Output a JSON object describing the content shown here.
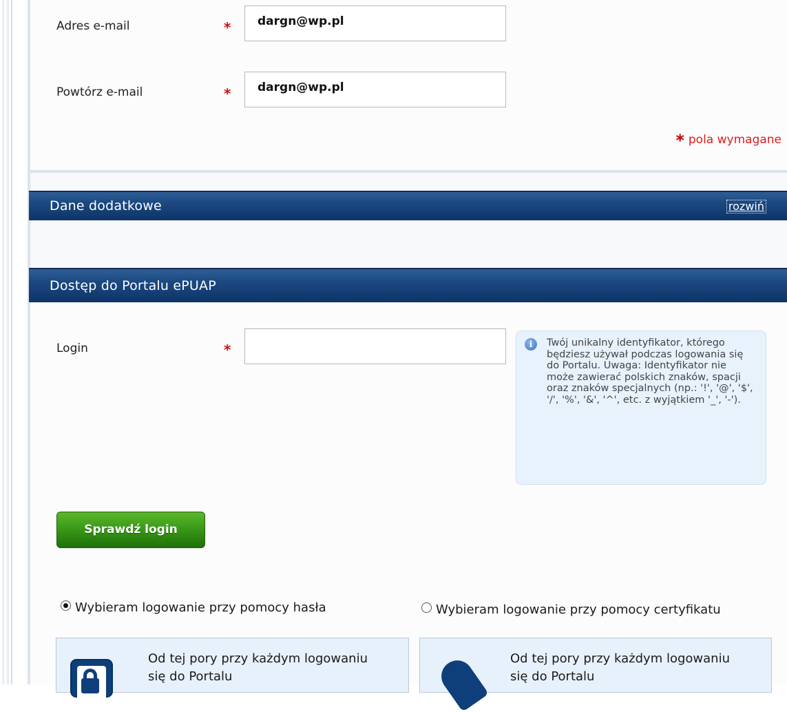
{
  "contact_section": {
    "fields": [
      {
        "label": "Adres e-mail",
        "value": "dargn@wp.pl"
      },
      {
        "label": "Powtórz e-mail",
        "value": "dargn@wp.pl"
      }
    ],
    "required_marker": "*",
    "required_note": "pola wymagane",
    "required_note_marker": "*"
  },
  "additional_section": {
    "title": "Dane dodatkowe",
    "expand_link": "rozwiń"
  },
  "access_section": {
    "title": "Dostęp do Portalu ePUAP",
    "login_label": "Login",
    "login_value": "",
    "login_info": "Twój unikalny identyfikator, którego będziesz używał podczas logowania się do Portalu. Uwaga: Identyfikator nie może zawierać polskich znaków, spacji oraz znaków specjalnych (np.: '!', '@', '$', '/', '%', '&', '^', etc. z wyjątkiem '_', '-').",
    "info_icon": "info-icon",
    "check_button": "Sprawdź login",
    "login_options": [
      {
        "label": "Wybieram logowanie przy pomocy hasła",
        "selected": true,
        "icon": "lock-icon",
        "description": "Od tej pory przy każdym logowaniu się do Portalu"
      },
      {
        "label": "Wybieram logowanie przy pomocy certyfikatu",
        "selected": false,
        "icon": "certificate-icon",
        "description": "Od tej pory przy każdym logowaniu się do Portalu"
      }
    ]
  },
  "colors": {
    "header_bar": "#1d4a82",
    "required": "#cc1111",
    "button_green": "#3b9a18",
    "info_bg": "#e7f2fd"
  }
}
